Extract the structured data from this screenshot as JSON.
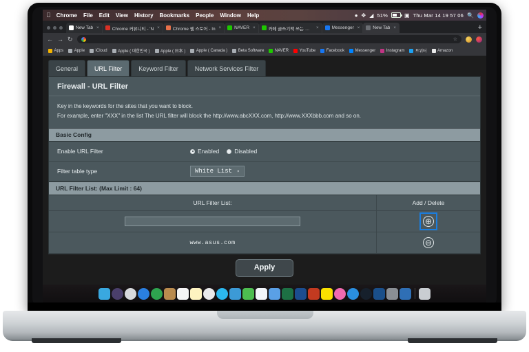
{
  "macos_menubar": {
    "apple_icon": "apple-icon",
    "items": [
      "Chrome",
      "File",
      "Edit",
      "View",
      "History",
      "Bookmarks",
      "People",
      "Window",
      "Help"
    ],
    "status": {
      "battery_percent": "51%",
      "clock": "Thu Mar 14  19 57 06",
      "icons": [
        "dropbox-icon",
        "bluetooth-icon",
        "wifi-icon",
        "battery-icon",
        "input-source-icon",
        "spotlight-search-icon",
        "siri-icon",
        "control-center-icon"
      ]
    }
  },
  "browser": {
    "tabs": [
      {
        "label": "New Tab",
        "favicon_color": "#ffffff",
        "active": false
      },
      {
        "label": "Chrome 커뮤니티 - 'N",
        "favicon_color": "#d93025",
        "active": false
      },
      {
        "label": "Chrome 웹 스토어 - In",
        "favicon_color": "#e8714a",
        "active": false
      },
      {
        "label": "NAVER",
        "favicon_color": "#1ec800",
        "active": false
      },
      {
        "label": "카페 글쓰기책 쓰는 사람",
        "favicon_color": "#1ec800",
        "active": false
      },
      {
        "label": "Messenger",
        "favicon_color": "#1877f2",
        "active": false
      },
      {
        "label": "New Tab",
        "favicon_color": "#6b6e73",
        "active": true
      }
    ],
    "new_tab_label": "+",
    "close_label": "×",
    "toolbar": {
      "back_icon": "←",
      "forward_icon": "→",
      "reload_icon": "↻",
      "omnibox_value": "",
      "omnibox_placeholder": "",
      "star_icon": "☆"
    },
    "bookmarks": [
      {
        "label": "Apps",
        "color": "#f4b400"
      },
      {
        "label": "Apple",
        "color": "#a8adb3"
      },
      {
        "label": "iCloud",
        "color": "#a8adb3"
      },
      {
        "label": "Apple ( 대한민국 )",
        "color": "#a8adb3"
      },
      {
        "label": "Apple ( 日本 )",
        "color": "#a8adb3"
      },
      {
        "label": "Apple ( Canada )",
        "color": "#a8adb3"
      },
      {
        "label": "Beta Software",
        "color": "#a8adb3"
      },
      {
        "label": "NAVER",
        "color": "#1ec800"
      },
      {
        "label": "YouTube",
        "color": "#ff0000"
      },
      {
        "label": "Facebook",
        "color": "#1877f2"
      },
      {
        "label": "Messenger",
        "color": "#0084ff"
      },
      {
        "label": "Instagram",
        "color": "#c13584"
      },
      {
        "label": "트위터",
        "color": "#1da1f2"
      },
      {
        "label": "Amazon",
        "color": "#eaeaea"
      }
    ]
  },
  "router": {
    "tabs": [
      {
        "label": "General",
        "active": false
      },
      {
        "label": "URL Filter",
        "active": true
      },
      {
        "label": "Keyword Filter",
        "active": false
      },
      {
        "label": "Network Services Filter",
        "active": false
      }
    ],
    "page_title": "Firewall - URL Filter",
    "description_line1": "Key in the keywords for the sites that you want to block.",
    "description_line2": "For example, enter \"XXX\" in the list The URL filter will block the http://www.abcXXX.com, http://www.XXXbbb.com and so on.",
    "basic_config": {
      "section_title": "Basic Config",
      "enable_label": "Enable URL Filter",
      "radio_enabled": "Enabled",
      "radio_disabled": "Disabled",
      "selected_radio": "Enabled",
      "filter_table_label": "Filter table type",
      "filter_table_value": "White List",
      "filter_table_caret": "▾"
    },
    "filter_list": {
      "section_title": "URL Filter List: (Max Limit : 64)",
      "col_url": "URL Filter List:",
      "col_action": "Add / Delete",
      "input_value": "",
      "add_icon": "⊕",
      "add_icon_name": "add-circle-icon",
      "entries": [
        {
          "url": "www.asus.com",
          "delete_icon": "⊖"
        }
      ],
      "focus_color": "#1a7ee0"
    },
    "apply_label": "Apply"
  },
  "dock": {
    "items": [
      {
        "name": "finder-icon",
        "color": "#39a8e0",
        "round": false
      },
      {
        "name": "siri-icon",
        "color": "#4a3f6b",
        "round": true
      },
      {
        "name": "launchpad-icon",
        "color": "#d7d9dc",
        "round": true
      },
      {
        "name": "safari-icon",
        "color": "#2a7fe0",
        "round": true
      },
      {
        "name": "chrome-icon",
        "color": "#2ea44f",
        "round": true
      },
      {
        "name": "contacts-icon",
        "color": "#b98b4e",
        "round": false
      },
      {
        "name": "calendar-icon",
        "color": "#f5f5f5",
        "round": false
      },
      {
        "name": "notes-icon",
        "color": "#fdf3c0",
        "round": false
      },
      {
        "name": "photos-icon",
        "color": "#e9e9ea",
        "round": true
      },
      {
        "name": "messages-icon",
        "color": "#2bb8ef",
        "round": true
      },
      {
        "name": "keynote-icon",
        "color": "#3c9ad6",
        "round": false
      },
      {
        "name": "numbers-icon",
        "color": "#4dbd50",
        "round": false
      },
      {
        "name": "pages-icon",
        "color": "#f2f6fa",
        "round": false
      },
      {
        "name": "preview-icon",
        "color": "#5aa0e6",
        "round": false
      },
      {
        "name": "excel-icon",
        "color": "#1d7044",
        "round": false
      },
      {
        "name": "word-icon",
        "color": "#1b4d8f",
        "round": false
      },
      {
        "name": "powerpoint-icon",
        "color": "#c33a20",
        "round": false
      },
      {
        "name": "kakaotalk-icon",
        "color": "#fae100",
        "round": false
      },
      {
        "name": "itunes-icon",
        "color": "#f06ab0",
        "round": true
      },
      {
        "name": "app-store-icon",
        "color": "#2a8fe0",
        "round": true
      },
      {
        "name": "steam-icon",
        "color": "#16202c",
        "round": true
      },
      {
        "name": "blender-icon",
        "color": "#1a4f8a",
        "round": false
      },
      {
        "name": "system-preferences-icon",
        "color": "#8a8f95",
        "round": false
      },
      {
        "name": "remote-desktop-icon",
        "color": "#2f6fb5",
        "round": false
      },
      {
        "name": "trash-icon",
        "color": "#c9cdd2",
        "round": false
      }
    ]
  }
}
